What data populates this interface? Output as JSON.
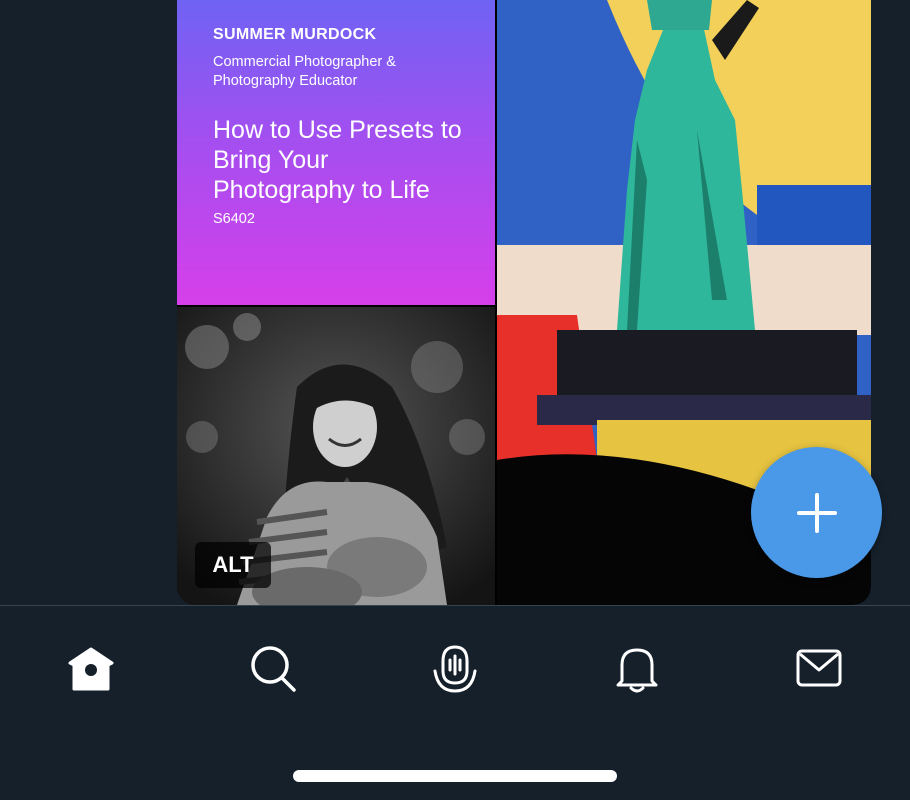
{
  "post_media": {
    "promo": {
      "speaker": "SUMMER MURDOCK",
      "role": "Commercial Photographer & Photography Educator",
      "title": "How to Use Presets to Bring Your Photography to Life",
      "session_code": "S6402"
    },
    "alt_badge": "ALT"
  },
  "fab": {
    "icon": "plus-icon"
  },
  "tab_bar": {
    "items": [
      {
        "name": "home",
        "icon": "home-icon"
      },
      {
        "name": "search",
        "icon": "search-icon"
      },
      {
        "name": "spaces",
        "icon": "spaces-icon"
      },
      {
        "name": "notifications",
        "icon": "bell-icon"
      },
      {
        "name": "messages",
        "icon": "mail-icon"
      }
    ]
  },
  "colors": {
    "background": "#15202b",
    "accent": "#4a99e9",
    "promo_gradient_top": "#6f63f4",
    "promo_gradient_bottom": "#d63fea"
  }
}
